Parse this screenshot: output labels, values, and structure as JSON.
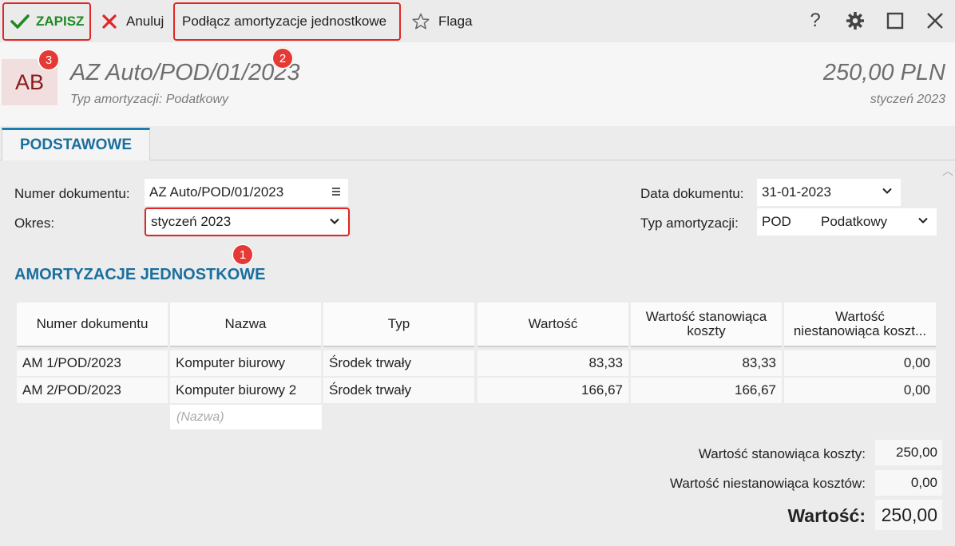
{
  "toolbar": {
    "save_label": "ZAPISZ",
    "cancel_label": "Anuluj",
    "attach_label": "Podłącz amortyzacje jednostkowe",
    "flag_label": "Flaga",
    "help_label": "?",
    "badge_save": "3",
    "badge_attach": "2"
  },
  "header": {
    "avatar": "AB",
    "title": "AZ Auto/POD/01/2023",
    "subtitle": "Typ amortyzacji: Podatkowy",
    "amount": "250,00 PLN",
    "period": "styczeń 2023"
  },
  "tabs": [
    {
      "label": "PODSTAWOWE"
    }
  ],
  "form": {
    "doc_number_label": "Numer dokumentu:",
    "doc_number_value": "AZ Auto/POD/01/2023",
    "period_label": "Okres:",
    "period_value": "styczeń 2023",
    "badge_period": "1",
    "doc_date_label": "Data dokumentu:",
    "doc_date_value": "31-01-2023",
    "amort_type_label": "Typ amortyzacji:",
    "amort_type_code": "POD",
    "amort_type_name": "Podatkowy"
  },
  "section": {
    "title": "AMORTYZACJE JEDNOSTKOWE"
  },
  "table": {
    "columns": [
      "Numer dokumentu",
      "Nazwa",
      "Typ",
      "Wartość",
      "Wartość stanowiąca koszty",
      "Wartość niestanowiąca koszt..."
    ],
    "rows": [
      {
        "doc": "AM 1/POD/2023",
        "name": "Komputer biurowy",
        "type": "Środek trwały",
        "value": "83,33",
        "cost": "83,33",
        "noncost": "0,00"
      },
      {
        "doc": "AM 2/POD/2023",
        "name": "Komputer biurowy 2",
        "type": "Środek trwały",
        "value": "166,67",
        "cost": "166,67",
        "noncost": "0,00"
      }
    ],
    "new_row_placeholder": "(Nazwa)"
  },
  "summary": {
    "cost_label": "Wartość stanowiąca koszty:",
    "cost_value": "250,00",
    "noncost_label": "Wartość niestanowiąca kosztów:",
    "noncost_value": "0,00",
    "total_label": "Wartość:",
    "total_value": "250,00"
  },
  "colors": {
    "accent_blue": "#1a6f9e",
    "save_green": "#1e8a22",
    "cancel_red": "#e02727",
    "highlight_red": "#e02727"
  },
  "icons": [
    "check-icon",
    "close-icon",
    "star-icon",
    "help-icon",
    "gear-icon",
    "maximize-icon",
    "window-close-icon",
    "hamburger-icon",
    "chevron-down-icon"
  ]
}
